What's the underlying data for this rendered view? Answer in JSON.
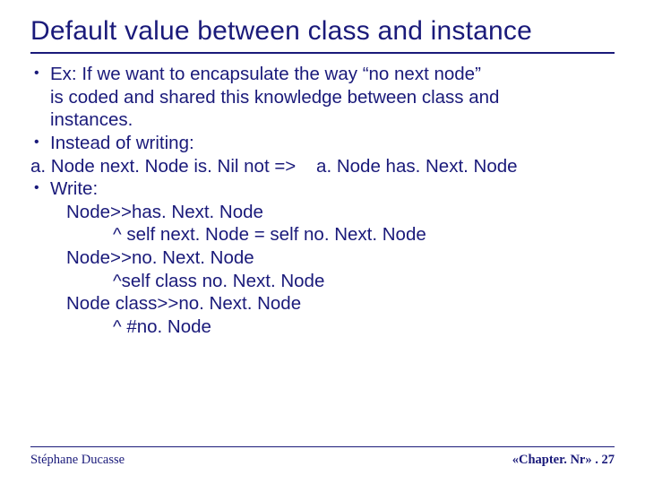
{
  "title": "Default value between class and instance",
  "bullets": {
    "b1_l1": "Ex: If we want to encapsulate the way “no next node”",
    "b1_l2": "is coded and shared this knowledge between class and",
    "b1_l3": "instances.",
    "b2_l1": "Instead of writing:",
    "b2_code": "a. Node next. Node is. Nil not =>    a. Node has. Next. Node",
    "b3_l1": "Write:",
    "b3_c1": "Node>>has. Next. Node",
    "b3_c2": "^ self next. Node = self no. Next. Node",
    "b3_c3": "Node>>no. Next. Node",
    "b3_c4": "^self class no. Next. Node",
    "b3_c5": "Node class>>no. Next. Node",
    "b3_c6": "^ #no. Node"
  },
  "footer": {
    "author": "Stéphane Ducasse",
    "pageref": "«Chapter. Nr» . 27"
  }
}
